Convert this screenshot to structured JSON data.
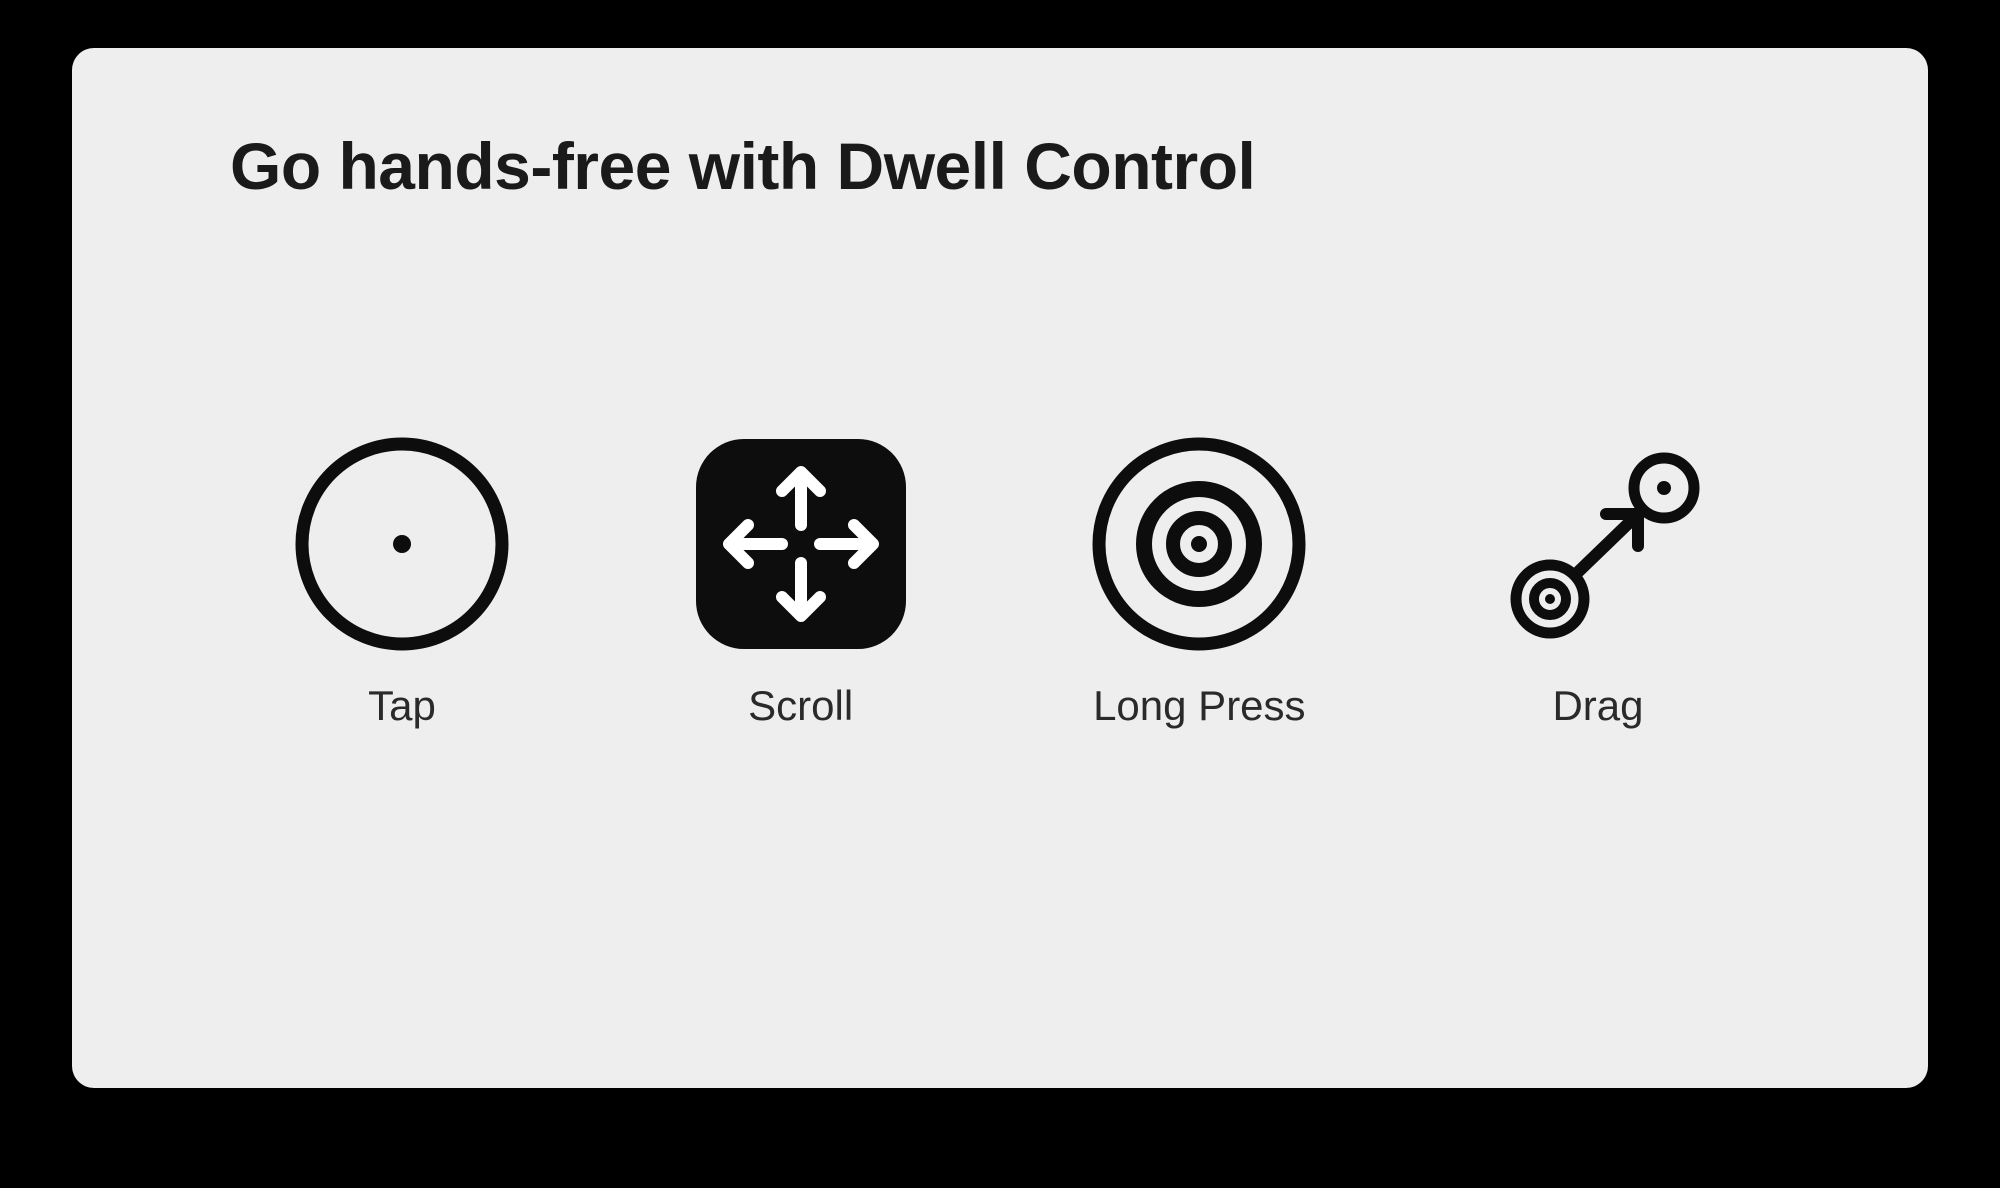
{
  "card": {
    "title": "Go hands-free with Dwell Control",
    "options": [
      {
        "label": "Tap",
        "icon": "tap-icon"
      },
      {
        "label": "Scroll",
        "icon": "scroll-icon"
      },
      {
        "label": "Long Press",
        "icon": "long-press-icon"
      },
      {
        "label": "Drag",
        "icon": "drag-icon"
      }
    ]
  },
  "colors": {
    "background": "#000000",
    "card": "#eeeeee",
    "text": "#1a1a1a",
    "iconFill": "#0d0d0d",
    "white": "#ffffff"
  }
}
